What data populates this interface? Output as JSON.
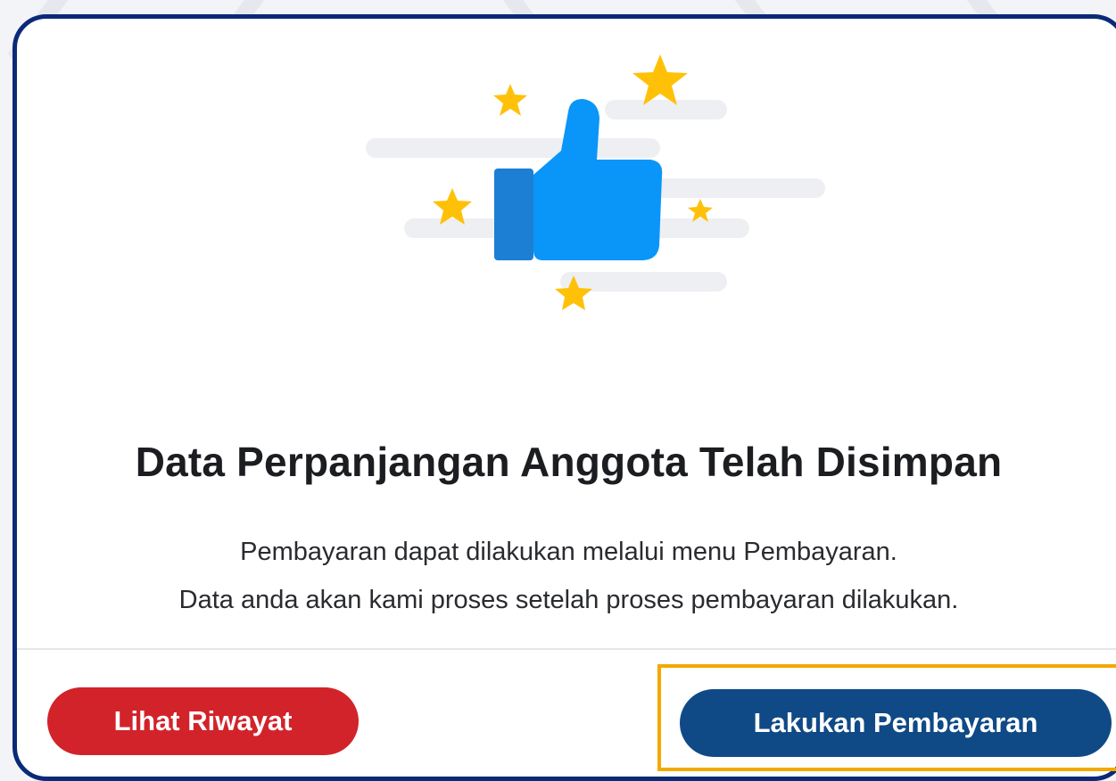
{
  "dialog": {
    "title": "Data Perpanjangan Anggota Telah Disimpan",
    "message_line1": "Pembayaran dapat dilakukan melalui menu Pembayaran.",
    "message_line2": "Data anda akan kami proses setelah proses pembayaran dilakukan.",
    "illustration": "thumbs-up-with-stars"
  },
  "buttons": {
    "history_label": "Lihat Riwayat",
    "pay_label": "Lakukan Pembayaran"
  },
  "colors": {
    "modal_border": "#0a2a78",
    "history_button": "#d2232a",
    "pay_button": "#0f4a86",
    "highlight": "#f2a900",
    "thumb": "#0a96f8",
    "star": "#ffc107"
  }
}
